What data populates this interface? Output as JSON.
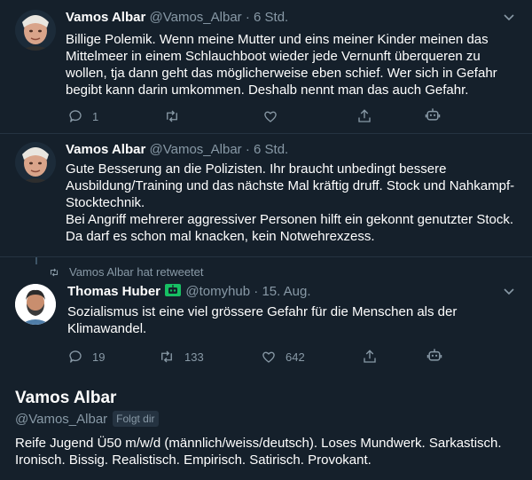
{
  "tweets": [
    {
      "name": "Vamos Albar",
      "handle": "@Vamos_Albar",
      "time": "· 6 Std.",
      "text": "Billige Polemik. Wenn meine Mutter und eins meiner Kinder meinen das Mittelmeer in einem Schlauchboot wieder jede Vernunft überqueren zu wollen, tja dann geht das möglicherweise eben schief. Wer sich in Gefahr begibt kann darin umkommen. Deshalb nennt man das auch Gefahr.",
      "replies": "1",
      "retweets": "",
      "likes": ""
    },
    {
      "name": "Vamos Albar",
      "handle": "@Vamos_Albar",
      "time": "· 6 Std.",
      "text": "Gute Besserung an die Polizisten. Ihr braucht unbedingt bessere Ausbildung/Training und das nächste Mal kräftig druff. Stock und Nahkampf-Stocktechnik.\nBei Angriff mehrerer aggressiver Personen hilft ein gekonnt genutzter Stock. Da darf es schon mal knacken, kein Notwehrexzess."
    },
    {
      "retweet_context": "Vamos Albar hat retweetet",
      "name": "Thomas Huber",
      "handle": "@tomyhub",
      "time": "· 15. Aug.",
      "text": "Sozialismus ist eine viel grössere Gefahr für die Menschen als der Klimawandel.",
      "replies": "19",
      "retweets": "133",
      "likes": "642"
    }
  ],
  "profile": {
    "name": "Vamos Albar",
    "handle": "@Vamos_Albar",
    "follows_badge": "Folgt dir",
    "bio": "Reife Jugend Ü50 m/w/d (männlich/weiss/deutsch). Loses Mundwerk. Sarkastisch. Ironisch. Bissig. Realistisch. Empirisch. Satirisch. Provokant."
  },
  "colors": {
    "background": "#15202b",
    "muted": "#8899a6",
    "retweet_green": "#17bf63",
    "divider": "#253341"
  },
  "icons": [
    "reply-icon",
    "retweet-icon",
    "like-icon",
    "share-icon",
    "bot-icon",
    "chevron-down-icon",
    "verified-badge-icon"
  ]
}
